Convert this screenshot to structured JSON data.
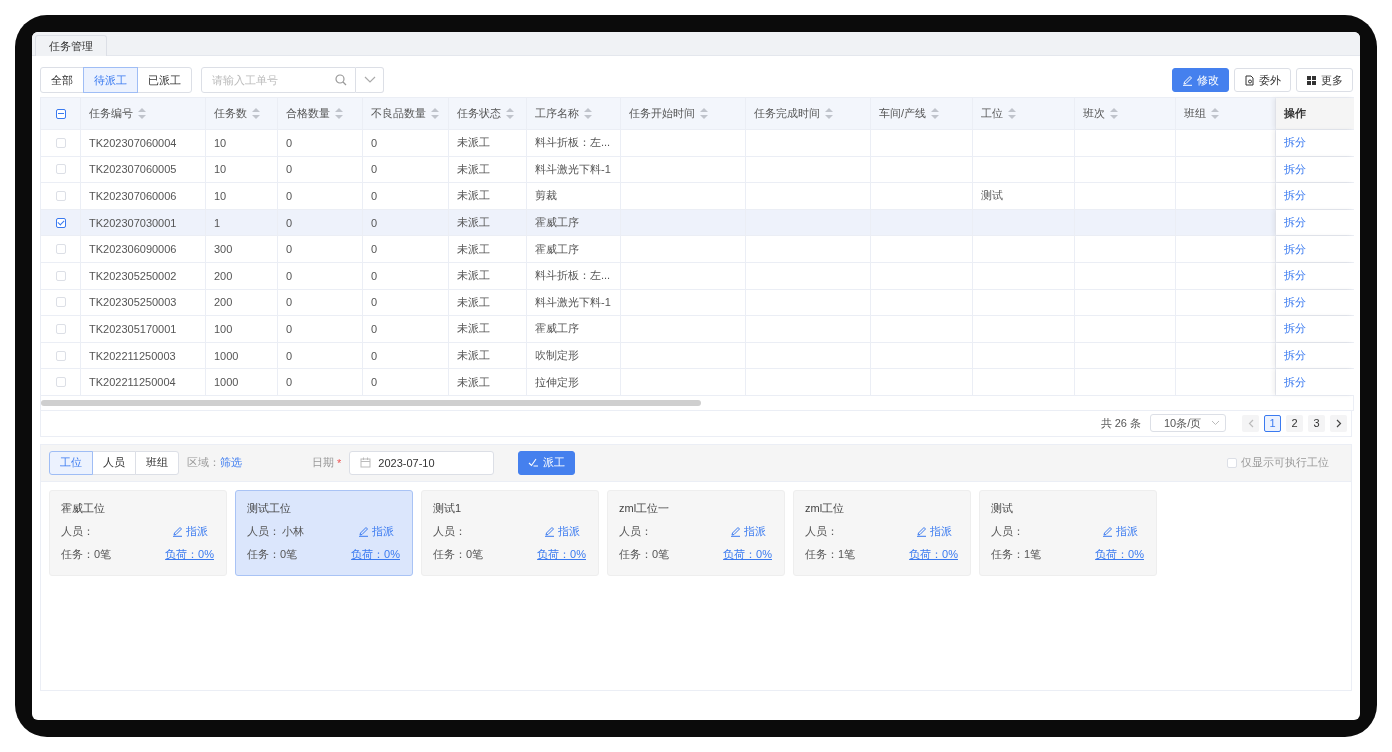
{
  "page_tabs": [
    {
      "label": "任务管理"
    }
  ],
  "filter_tabs": [
    {
      "label": "全部",
      "selected": false
    },
    {
      "label": "待派工",
      "selected": true
    },
    {
      "label": "已派工",
      "selected": false
    }
  ],
  "search": {
    "placeholder": "请输入工单号"
  },
  "actions": [
    {
      "kind": "edit",
      "label": "修改",
      "primary": true
    },
    {
      "kind": "outsource",
      "label": "委外",
      "primary": false
    },
    {
      "kind": "more",
      "label": "更多",
      "primary": false
    }
  ],
  "table": {
    "select_all": {
      "partial": true
    },
    "columns": [
      {
        "label": "任务编号",
        "sortable": true
      },
      {
        "label": "任务数",
        "sortable": true
      },
      {
        "label": "合格数量",
        "sortable": true
      },
      {
        "label": "不良品数量",
        "sortable": true
      },
      {
        "label": "任务状态",
        "sortable": true
      },
      {
        "label": "工序名称",
        "sortable": true
      },
      {
        "label": "任务开始时间",
        "sortable": true
      },
      {
        "label": "任务完成时间",
        "sortable": true
      },
      {
        "label": "车间/产线",
        "sortable": true
      },
      {
        "label": "工位",
        "sortable": true
      },
      {
        "label": "班次",
        "sortable": true
      },
      {
        "label": "班组",
        "sortable": true
      },
      {
        "label": "操作",
        "sortable": false
      }
    ],
    "rows": [
      {
        "selected": false,
        "cells": [
          "TK202307060004",
          "10",
          "0",
          "0",
          "未派工",
          "料斗折板：左...",
          "",
          "",
          "",
          "",
          "",
          ""
        ],
        "action": "拆分"
      },
      {
        "selected": false,
        "cells": [
          "TK202307060005",
          "10",
          "0",
          "0",
          "未派工",
          "料斗激光下料-1",
          "",
          "",
          "",
          "",
          "",
          ""
        ],
        "action": "拆分"
      },
      {
        "selected": false,
        "cells": [
          "TK202307060006",
          "10",
          "0",
          "0",
          "未派工",
          "剪裁",
          "",
          "",
          "",
          "测试",
          "",
          ""
        ],
        "action": "拆分"
      },
      {
        "selected": true,
        "cells": [
          "TK202307030001",
          "1",
          "0",
          "0",
          "未派工",
          "霍威工序",
          "",
          "",
          "",
          "",
          "",
          ""
        ],
        "action": "拆分"
      },
      {
        "selected": false,
        "cells": [
          "TK202306090006",
          "300",
          "0",
          "0",
          "未派工",
          "霍威工序",
          "",
          "",
          "",
          "",
          "",
          ""
        ],
        "action": "拆分"
      },
      {
        "selected": false,
        "cells": [
          "TK202305250002",
          "200",
          "0",
          "0",
          "未派工",
          "料斗折板：左...",
          "",
          "",
          "",
          "",
          "",
          ""
        ],
        "action": "拆分"
      },
      {
        "selected": false,
        "cells": [
          "TK202305250003",
          "200",
          "0",
          "0",
          "未派工",
          "料斗激光下料-1",
          "",
          "",
          "",
          "",
          "",
          ""
        ],
        "action": "拆分"
      },
      {
        "selected": false,
        "cells": [
          "TK202305170001",
          "100",
          "0",
          "0",
          "未派工",
          "霍威工序",
          "",
          "",
          "",
          "",
          "",
          ""
        ],
        "action": "拆分"
      },
      {
        "selected": false,
        "cells": [
          "TK202211250003",
          "1000",
          "0",
          "0",
          "未派工",
          "吹制定形",
          "",
          "",
          "",
          "",
          "",
          ""
        ],
        "action": "拆分"
      },
      {
        "selected": false,
        "cells": [
          "TK202211250004",
          "1000",
          "0",
          "0",
          "未派工",
          "拉伸定形",
          "",
          "",
          "",
          "",
          "",
          ""
        ],
        "action": "拆分"
      }
    ]
  },
  "pagination": {
    "total": "共 26 条",
    "page_size": "10条/页",
    "pages": [
      {
        "label": "1",
        "selected": true
      },
      {
        "label": "2",
        "selected": false
      },
      {
        "label": "3",
        "selected": false
      }
    ]
  },
  "dispatch": {
    "tabs": [
      {
        "label": "工位",
        "selected": true
      },
      {
        "label": "人员",
        "selected": false
      },
      {
        "label": "班组",
        "selected": false
      }
    ],
    "area_label": "区域：",
    "area_link": "筛选",
    "date_label": "日期",
    "required_mark": "*",
    "date_value": "2023-07-10",
    "dispatch_button": "派工",
    "only_executable": {
      "label": "仅显示可执行工位",
      "checked": false
    },
    "cards": [
      {
        "name": "霍威工位",
        "person_label": "人员：",
        "assign": "指派",
        "tasks": "任务：0笔",
        "load": "负荷：0%",
        "selected": false
      },
      {
        "name": "测试工位",
        "person_label": "人员：",
        "person": "小林",
        "assign": "指派",
        "tasks": "任务：0笔",
        "load": "负荷：0%",
        "selected": true
      },
      {
        "name": "测试1",
        "person_label": "人员：",
        "assign": "指派",
        "tasks": "任务：0笔",
        "load": "负荷：0%",
        "selected": false
      },
      {
        "name": "zml工位一",
        "person_label": "人员：",
        "assign": "指派",
        "tasks": "任务：0笔",
        "load": "负荷：0%",
        "selected": false
      },
      {
        "name": "zml工位",
        "person_label": "人员：",
        "assign": "指派",
        "tasks": "任务：1笔",
        "load": "负荷：0%",
        "selected": false
      },
      {
        "name": "测试",
        "person_label": "人员：",
        "assign": "指派",
        "tasks": "任务：1笔",
        "load": "负荷：0%",
        "selected": false
      }
    ]
  }
}
